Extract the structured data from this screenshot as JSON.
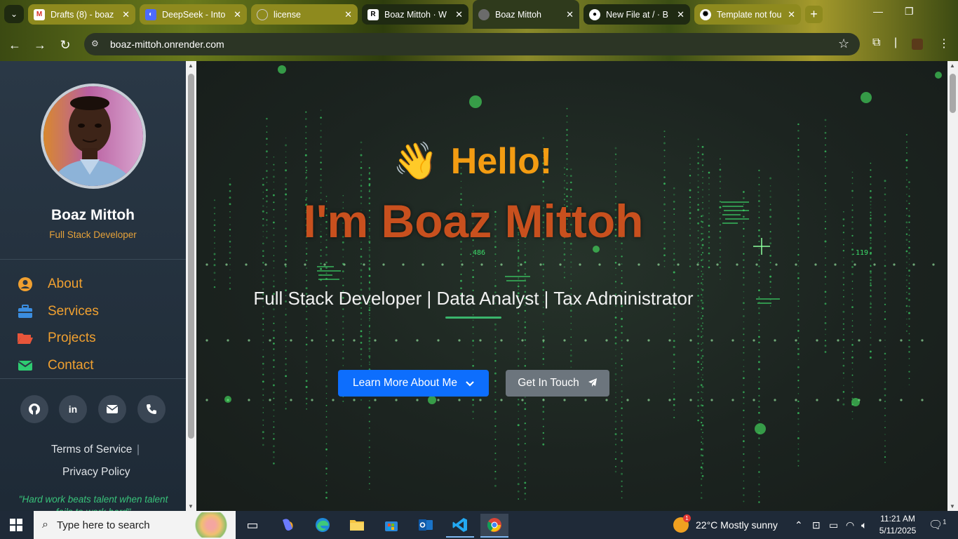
{
  "browser": {
    "tabs": [
      {
        "title": "Drafts (8) - boaz",
        "favicon": "gmail-icon"
      },
      {
        "title": "DeepSeek - Into",
        "favicon": "deepseek-icon"
      },
      {
        "title": "license",
        "favicon": "globe-icon"
      },
      {
        "title": "Boaz Mittoh · W",
        "favicon": "render-icon"
      },
      {
        "title": "Boaz Mittoh",
        "favicon": "globe-icon"
      },
      {
        "title": "New File at / · B",
        "favicon": "github-icon"
      },
      {
        "title": "Template not fou",
        "favicon": "openai-icon"
      }
    ],
    "url": "boaz-mittoh.onrender.com"
  },
  "sidebar": {
    "name": "Boaz Mittoh",
    "role": "Full Stack Developer",
    "nav": [
      {
        "label": "About",
        "icon": "user-circle-icon"
      },
      {
        "label": "Services",
        "icon": "briefcase-icon"
      },
      {
        "label": "Projects",
        "icon": "folder-open-icon"
      },
      {
        "label": "Contact",
        "icon": "envelope-icon"
      }
    ],
    "social": [
      "github-icon",
      "linkedin-icon",
      "envelope-icon",
      "phone-icon"
    ],
    "social_text": {
      "linkedin": "in"
    },
    "terms": "Terms of Service",
    "terms_sep": "|",
    "privacy": "Privacy Policy",
    "quote": "\"Hard work beats talent when talent fails to work hard\""
  },
  "hero": {
    "hello": "Hello!",
    "wave_emoji": "👋",
    "name": "I'm Boaz Mittoh",
    "tagline": "Full Stack Developer | Data Analyst | Tax Administrator",
    "primary_button": "Learn More About Me",
    "secondary_button": "Get In Touch",
    "bg_numbers": [
      ".486",
      ".119"
    ]
  },
  "taskbar": {
    "search_placeholder": "Type here to search",
    "weather": "22°C  Mostly sunny",
    "weather_badge": "1",
    "time": "11:21 AM",
    "date": "5/11/2025",
    "notif_count": "1"
  },
  "colors": {
    "accent_orange": "#f39c12",
    "name_color": "#c8501e",
    "primary_btn": "#0d6efd",
    "secondary_btn": "#6c757d",
    "sidebar_bg": "#2a3846",
    "quote_green": "#38c27a"
  }
}
